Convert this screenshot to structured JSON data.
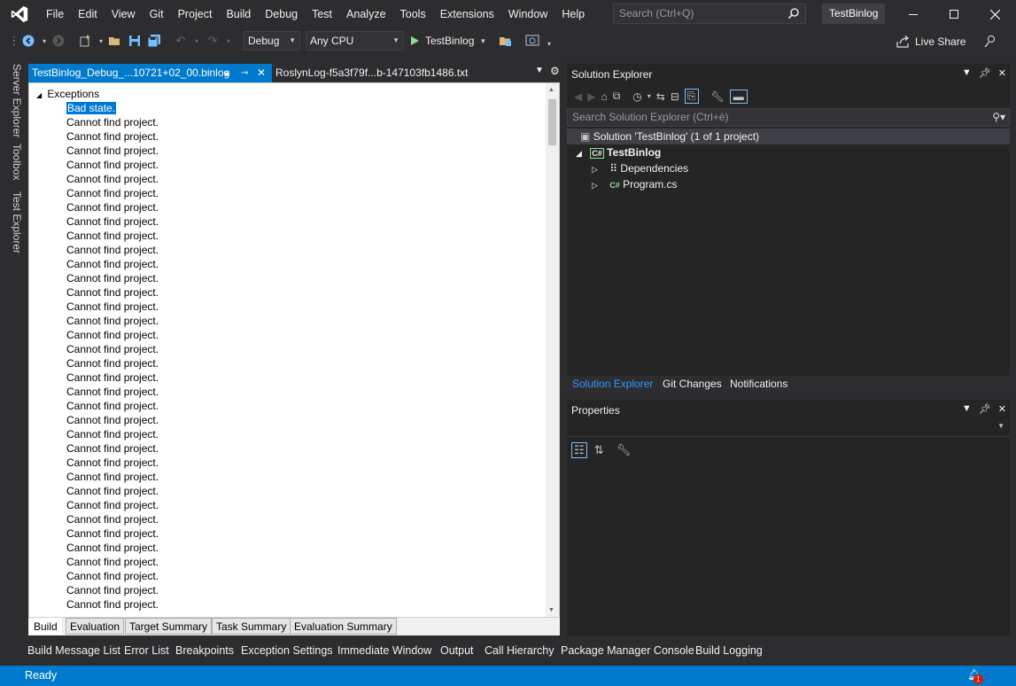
{
  "menu": [
    "File",
    "Edit",
    "View",
    "Git",
    "Project",
    "Build",
    "Debug",
    "Test",
    "Analyze",
    "Tools",
    "Extensions",
    "Window",
    "Help"
  ],
  "search": {
    "placeholder": "Search (Ctrl+Q)"
  },
  "solution_name": "TestBinlog",
  "toolbar": {
    "config": "Debug",
    "platform": "Any CPU",
    "run_target": "TestBinlog",
    "live_share": "Live Share"
  },
  "left_tabs": [
    "Server Explorer",
    "Toolbox",
    "Test Explorer"
  ],
  "doc_tabs": {
    "active": "TestBinlog_Debug_...10721+02_00.binlog",
    "second": "RoslynLog-f5a3f79f...b-147103fb1486.txt"
  },
  "tree": {
    "root": "Exceptions",
    "selected": "Bad state.",
    "items": [
      "Cannot find project.",
      "Cannot find project.",
      "Cannot find project.",
      "Cannot find project.",
      "Cannot find project.",
      "Cannot find project.",
      "Cannot find project.",
      "Cannot find project.",
      "Cannot find project.",
      "Cannot find project.",
      "Cannot find project.",
      "Cannot find project.",
      "Cannot find project.",
      "Cannot find project.",
      "Cannot find project.",
      "Cannot find project.",
      "Cannot find project.",
      "Cannot find project.",
      "Cannot find project.",
      "Cannot find project.",
      "Cannot find project.",
      "Cannot find project.",
      "Cannot find project.",
      "Cannot find project.",
      "Cannot find project.",
      "Cannot find project.",
      "Cannot find project.",
      "Cannot find project.",
      "Cannot find project.",
      "Cannot find project.",
      "Cannot find project.",
      "Cannot find project.",
      "Cannot find project.",
      "Cannot find project.",
      "Cannot find project."
    ]
  },
  "doc_bottom_tabs": [
    "Build",
    "Evaluation",
    "Target Summary",
    "Task Summary",
    "Evaluation Summary"
  ],
  "solution_explorer": {
    "title": "Solution Explorer",
    "search_placeholder": "Search Solution Explorer (Ctrl+è)",
    "solution": "Solution 'TestBinlog' (1 of 1 project)",
    "project": "TestBinlog",
    "dependencies": "Dependencies",
    "program": "Program.cs",
    "tabs": [
      "Solution Explorer",
      "Git Changes",
      "Notifications"
    ]
  },
  "properties": {
    "title": "Properties"
  },
  "bottom_tabs": [
    "Build Message List",
    "Error List",
    "Breakpoints",
    "Exception Settings",
    "Immediate Window",
    "Output",
    "Call Hierarchy",
    "Package Manager Console",
    "Build Logging"
  ],
  "status": {
    "text": "Ready",
    "notification_count": "1"
  },
  "colors": {
    "accent": "#007acc",
    "background": "#2d2d30",
    "panel": "#252526"
  }
}
